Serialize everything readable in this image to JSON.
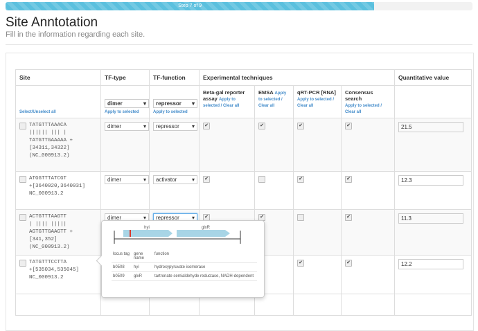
{
  "progress": {
    "label": "Step 7 of 9",
    "percent": 79,
    "color": "#5bc0de"
  },
  "page": {
    "title": "Site Anntotation",
    "subtitle": "Fill in the information regarding each site."
  },
  "table": {
    "headers": {
      "site": "Site",
      "tf_type": "TF-type",
      "tf_function": "TF-function",
      "exp": "Experimental techniques",
      "quant": "Quantitative value"
    },
    "select_all": "Select/Unselect all",
    "apply": "Apply to selected",
    "bulk": {
      "tf_type": "dimer",
      "tf_function": "repressor"
    },
    "techniques": [
      {
        "name": "Beta-gal reporter assay",
        "links": "Apply to selected / Clear all"
      },
      {
        "name": "EMSA",
        "links": "Apply to selected / Clear all"
      },
      {
        "name": "qRT-PCR [RNA]",
        "links": "Apply to selected / Clear all"
      },
      {
        "name": "Consensus search",
        "links": "Apply to selected / Clear all"
      }
    ],
    "rows": [
      {
        "seq": [
          "TATGTTTAAACA",
          "|||||| ||| |",
          "TATGTTGAAAAA +",
          "[34311,34322]",
          "(NC_000913.2)"
        ],
        "tf_type": "dimer",
        "tf_function": "repressor",
        "checks": [
          true,
          true,
          true,
          true
        ],
        "value": "21.5"
      },
      {
        "seq": [
          "ATGGTTTATCGT",
          "+[3640020,3640031]",
          "NC_000913.2"
        ],
        "tf_type": "dimer",
        "tf_function": "activator",
        "checks": [
          true,
          false,
          true,
          true
        ],
        "value": "12.3"
      },
      {
        "seq": [
          "ACTGTTTAAGTT",
          "| |||| |||||",
          "AGTGTTGAAGTT +[341,352]",
          "(NC_000913.2)"
        ],
        "tf_type": "dimer",
        "tf_function": "repressor",
        "checks": [
          true,
          true,
          false,
          true
        ],
        "value": "11.3"
      },
      {
        "seq": [
          "TATGTTTCCTTA",
          "+[535034,535045]",
          "NC_000913.2"
        ],
        "tf_type": "",
        "tf_function": "",
        "checks": [
          null,
          null,
          true,
          true
        ],
        "value": "12.2"
      }
    ]
  },
  "popover": {
    "genes": [
      "hyi",
      "glxR"
    ],
    "columns": [
      "locus tag",
      "gene name",
      "function"
    ],
    "rows": [
      [
        "b0508",
        "hyi",
        "hydroxypyruvate isomerase"
      ],
      [
        "b0509",
        "glxR",
        "tartronate semialdehyde reductase, NADH-dependent"
      ]
    ],
    "gene_color": "#a8d5e6",
    "site_color": "#d9372b"
  }
}
